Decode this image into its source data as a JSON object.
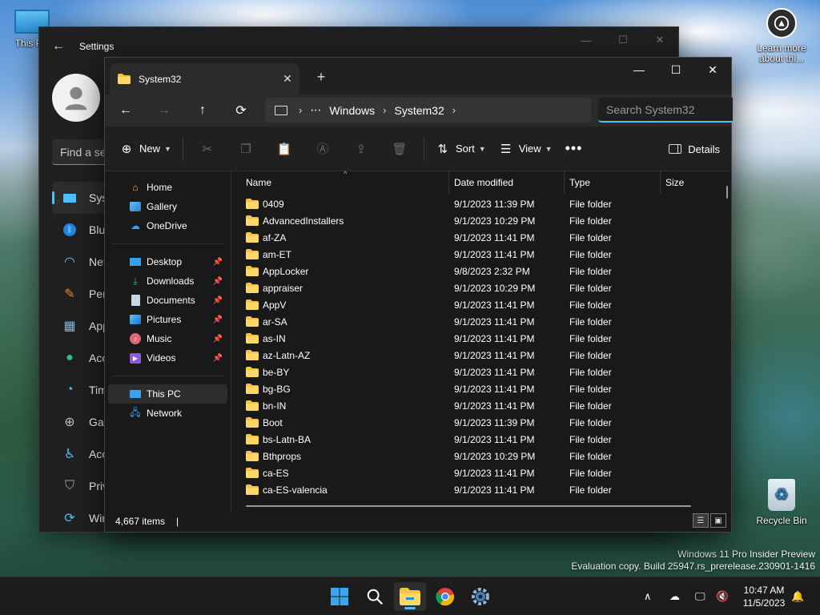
{
  "desktop": {
    "this_pc_label": "This PC",
    "learn_label": "Learn more about thi...",
    "recycle_label": "Recycle Bin",
    "watermark_line1": "Windows 11 Pro Insider Preview",
    "watermark_line2": "Evaluation copy. Build 25947.rs_prerelease.230901-1416"
  },
  "settings": {
    "title": "Settings",
    "find_placeholder": "Find a se",
    "nav": [
      {
        "label": "Syst",
        "icon": "system-icon"
      },
      {
        "label": "Blue",
        "icon": "bluetooth-icon"
      },
      {
        "label": "Net",
        "icon": "wifi-icon"
      },
      {
        "label": "Pers",
        "icon": "brush-icon"
      },
      {
        "label": "App",
        "icon": "apps-icon"
      },
      {
        "label": "Acc",
        "icon": "accounts-icon"
      },
      {
        "label": "Tim",
        "icon": "time-icon"
      },
      {
        "label": "Gan",
        "icon": "gaming-icon"
      },
      {
        "label": "Acc",
        "icon": "accessibility-icon"
      },
      {
        "label": "Priv",
        "icon": "shield-icon"
      },
      {
        "label": "Win",
        "icon": "update-icon"
      }
    ]
  },
  "explorer": {
    "tab_title": "System32",
    "breadcrumb": [
      "Windows",
      "System32"
    ],
    "search_placeholder": "Search System32",
    "toolbar": {
      "new_label": "New",
      "sort_label": "Sort",
      "view_label": "View",
      "details_label": "Details"
    },
    "navpane": {
      "top": [
        {
          "label": "Home",
          "icon": "home-icon"
        },
        {
          "label": "Gallery",
          "icon": "gallery-icon"
        },
        {
          "label": "OneDrive",
          "icon": "onedrive-icon"
        }
      ],
      "quick": [
        {
          "label": "Desktop",
          "icon": "desktop-icon"
        },
        {
          "label": "Downloads",
          "icon": "downloads-icon"
        },
        {
          "label": "Documents",
          "icon": "documents-icon"
        },
        {
          "label": "Pictures",
          "icon": "pictures-icon"
        },
        {
          "label": "Music",
          "icon": "music-icon"
        },
        {
          "label": "Videos",
          "icon": "videos-icon"
        }
      ],
      "bottom": [
        {
          "label": "This PC",
          "icon": "this-pc-icon",
          "selected": true
        },
        {
          "label": "Network",
          "icon": "network-icon"
        }
      ]
    },
    "columns": {
      "name": "Name",
      "date": "Date modified",
      "type": "Type",
      "size": "Size"
    },
    "rows": [
      {
        "name": "0409",
        "date": "9/1/2023 11:39 PM",
        "type": "File folder"
      },
      {
        "name": "AdvancedInstallers",
        "date": "9/1/2023 10:29 PM",
        "type": "File folder"
      },
      {
        "name": "af-ZA",
        "date": "9/1/2023 11:41 PM",
        "type": "File folder"
      },
      {
        "name": "am-ET",
        "date": "9/1/2023 11:41 PM",
        "type": "File folder"
      },
      {
        "name": "AppLocker",
        "date": "9/8/2023 2:32 PM",
        "type": "File folder"
      },
      {
        "name": "appraiser",
        "date": "9/1/2023 10:29 PM",
        "type": "File folder"
      },
      {
        "name": "AppV",
        "date": "9/1/2023 11:41 PM",
        "type": "File folder"
      },
      {
        "name": "ar-SA",
        "date": "9/1/2023 11:41 PM",
        "type": "File folder"
      },
      {
        "name": "as-IN",
        "date": "9/1/2023 11:41 PM",
        "type": "File folder"
      },
      {
        "name": "az-Latn-AZ",
        "date": "9/1/2023 11:41 PM",
        "type": "File folder"
      },
      {
        "name": "be-BY",
        "date": "9/1/2023 11:41 PM",
        "type": "File folder"
      },
      {
        "name": "bg-BG",
        "date": "9/1/2023 11:41 PM",
        "type": "File folder"
      },
      {
        "name": "bn-IN",
        "date": "9/1/2023 11:41 PM",
        "type": "File folder"
      },
      {
        "name": "Boot",
        "date": "9/1/2023 11:39 PM",
        "type": "File folder"
      },
      {
        "name": "bs-Latn-BA",
        "date": "9/1/2023 11:41 PM",
        "type": "File folder"
      },
      {
        "name": "Bthprops",
        "date": "9/1/2023 10:29 PM",
        "type": "File folder"
      },
      {
        "name": "ca-ES",
        "date": "9/1/2023 11:41 PM",
        "type": "File folder"
      },
      {
        "name": "ca-ES-valencia",
        "date": "9/1/2023 11:41 PM",
        "type": "File folder"
      }
    ],
    "status_count": "4,667 items"
  },
  "taskbar": {
    "time": "10:47 AM",
    "date": "11/5/2023"
  },
  "colors": {
    "accent": "#4cc2ff",
    "folder": "#f6c342",
    "window_bg": "#191919"
  }
}
